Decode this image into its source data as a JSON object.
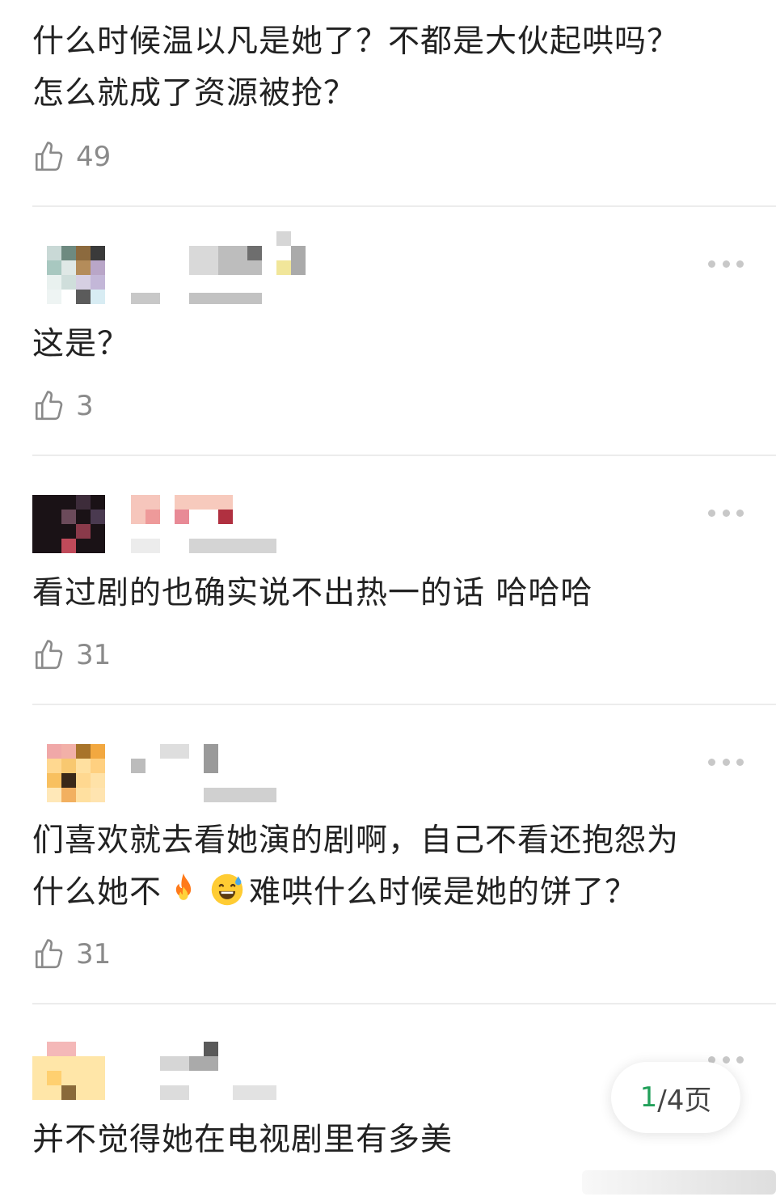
{
  "comments": [
    {
      "text_lines": [
        "什么时候温以凡是她了？不都是大伙起哄吗？",
        "怎么就成了资源被抢？"
      ],
      "likes": "49"
    },
    {
      "text_lines": [
        "这是？"
      ],
      "likes": "3"
    },
    {
      "text_lines": [
        "看过剧的也确实说不出热一的话 哈哈哈"
      ],
      "likes": "31"
    },
    {
      "text_lines": [
        "们喜欢就去看她演的剧啊，自己不看还抱怨为",
        "什么她不",
        "难哄什么时候是她的饼了？"
      ],
      "emojis": [
        "fire-emoji",
        "sweat-smile-emoji"
      ],
      "likes": "31"
    },
    {
      "text_lines": [
        "并不觉得她在电视剧里有多美"
      ]
    }
  ],
  "pager": {
    "current": "1",
    "rest": "/4页"
  },
  "colors": {
    "pager_current": "#22a05a",
    "like_count": "#8a8a8a",
    "divider": "#ececec"
  },
  "icons": {
    "like": "thumbs-up-icon",
    "more": "more-dots-icon"
  }
}
